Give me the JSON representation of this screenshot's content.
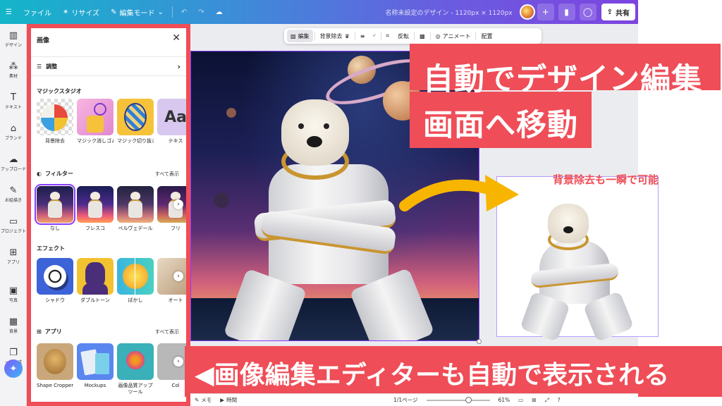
{
  "topbar": {
    "file": "ファイル",
    "resize": "リサイズ",
    "edit_mode": "編集モード",
    "doc_title": "名称未設定のデザイン - 1120px × 1120px",
    "share": "共有"
  },
  "rail": [
    {
      "icon": "layout-icon",
      "glyph": "▥",
      "label": "デザイン"
    },
    {
      "icon": "elements-icon",
      "glyph": "⁂",
      "label": "素材"
    },
    {
      "icon": "text-icon",
      "glyph": "T",
      "label": "テキスト"
    },
    {
      "icon": "brand-icon",
      "glyph": "⌂",
      "label": "ブランド"
    },
    {
      "icon": "upload-icon",
      "glyph": "☁",
      "label": "アップロード"
    },
    {
      "icon": "draw-icon",
      "glyph": "✎",
      "label": "お絵描き"
    },
    {
      "icon": "projects-icon",
      "glyph": "▭",
      "label": "プロジェクト"
    },
    {
      "icon": "apps-icon",
      "glyph": "⊞",
      "label": "アプリ"
    },
    {
      "icon": "photos-icon",
      "glyph": "▣",
      "label": "写真"
    },
    {
      "icon": "background-icon",
      "glyph": "▦",
      "label": "背景"
    },
    {
      "icon": "batch-icon",
      "glyph": "❐",
      "label": "一括作成"
    }
  ],
  "panel": {
    "title": "画像",
    "adjust": "調整",
    "magic_studio": "マジックスタジオ",
    "magic_items": [
      "背景除去",
      "マジック消しゴム",
      "マジック切り抜き",
      "テキス"
    ],
    "filters": "フィルター",
    "filters_see_all": "すべて表示",
    "filter_items": [
      "なし",
      "フレスコ",
      "ベルヴェデール",
      "フリ"
    ],
    "effects": "エフェクト",
    "effect_items": [
      "シャドウ",
      "ダブルトーン",
      "ぼかし",
      "オート"
    ],
    "apps": "アプリ",
    "apps_see_all": "すべて表示",
    "app_items": [
      "Shape Cropper",
      "Mockups",
      "画像品質アップツール",
      "Col"
    ]
  },
  "context_toolbar": {
    "edit": "編集",
    "bg_remove": "背景除去",
    "flip": "反転",
    "animate": "アニメート",
    "position": "配置"
  },
  "overlay": {
    "headline1": "自動でデザイン編集",
    "headline2": "画面へ移動",
    "bg_note": "背景除去も一瞬で可能",
    "bottom": "◀画像編集エディターも自動で表示される"
  },
  "statusbar": {
    "notes": "メモ",
    "timer": "時間",
    "pages": "1/1ページ",
    "zoom": "61%"
  },
  "colors": {
    "accent_red": "#ef4d57",
    "selection_purple": "#8b3dff",
    "arrow_yellow": "#f7b500"
  }
}
